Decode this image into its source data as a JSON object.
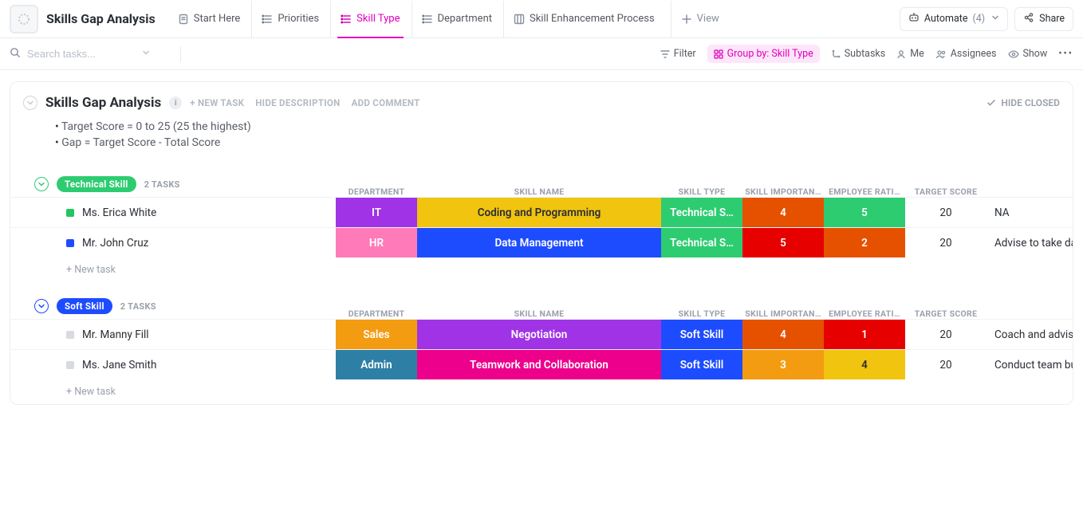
{
  "header": {
    "title": "Skills Gap Analysis"
  },
  "tabs": [
    {
      "label": "Start Here",
      "icon": "doc"
    },
    {
      "label": "Priorities",
      "icon": "list"
    },
    {
      "label": "Skill Type",
      "icon": "list",
      "active": true
    },
    {
      "label": "Department",
      "icon": "list"
    },
    {
      "label": "Skill Enhancement Process",
      "icon": "board"
    }
  ],
  "add_view_label": "View",
  "automate": {
    "label": "Automate",
    "count": "(4)"
  },
  "share_label": "Share",
  "search": {
    "placeholder": "Search tasks..."
  },
  "subbar": {
    "filter": "Filter",
    "groupby": "Group by: Skill Type",
    "subtasks": "Subtasks",
    "me": "Me",
    "assignees": "Assignees",
    "show": "Show"
  },
  "list": {
    "title": "Skills Gap Analysis",
    "new_task": "+ NEW TASK",
    "hide_desc": "HIDE DESCRIPTION",
    "add_comment": "ADD COMMENT",
    "hide_closed": "HIDE CLOSED",
    "description": [
      "Target Score = 0 to 25 (25 the highest)",
      "Gap = Target Score - Total Score"
    ]
  },
  "columns": [
    "DEPARTMENT",
    "SKILL NAME",
    "SKILL TYPE",
    "SKILL IMPORTAN…",
    "EMPLOYEE RATI…",
    "TARGET SCORE"
  ],
  "colors": {
    "green": "#2ecc71",
    "blue": "#1d4cff",
    "orange": "#f39c12",
    "darkorange": "#e65100",
    "red": "#e60000",
    "yellow": "#f1c40f",
    "purple": "#a033e6",
    "magenta": "#ec008c",
    "pink": "#ff6fb5",
    "steel": "#2d7fa6",
    "hrpink": "#ff7ab8"
  },
  "groups": [
    {
      "name": "Technical Skill",
      "pill_bg": "#2ecc71",
      "circle_stroke": "#2ecc71",
      "count": "2 TASKS",
      "rows": [
        {
          "name": "Ms. Erica White",
          "square": "green",
          "cells": [
            {
              "text": "IT",
              "bg": "#a033e6"
            },
            {
              "text": "Coding and Programming",
              "bg": "#f1c40f",
              "fg": "#2a2e34"
            },
            {
              "text": "Technical S…",
              "bg": "#2ecc71"
            },
            {
              "text": "4",
              "bg": "#e65100"
            },
            {
              "text": "5",
              "bg": "#2ecc71"
            }
          ],
          "target": "20",
          "note": "NA"
        },
        {
          "name": "Mr. John Cruz",
          "square": "blue",
          "cells": [
            {
              "text": "HR",
              "bg": "#ff7ab8"
            },
            {
              "text": "Data Management",
              "bg": "#1d4cff"
            },
            {
              "text": "Technical S…",
              "bg": "#2ecc71"
            },
            {
              "text": "5",
              "bg": "#e60000"
            },
            {
              "text": "2",
              "bg": "#e65100"
            }
          ],
          "target": "20",
          "note": "Advise to take data mana"
        }
      ]
    },
    {
      "name": "Soft Skill",
      "pill_bg": "#1d4cff",
      "circle_stroke": "#1d4cff",
      "count": "2 TASKS",
      "rows": [
        {
          "name": "Mr. Manny Fill",
          "square": "grey",
          "cells": [
            {
              "text": "Sales",
              "bg": "#f39c12"
            },
            {
              "text": "Negotiation",
              "bg": "#a033e6"
            },
            {
              "text": "Soft Skill",
              "bg": "#1d4cff"
            },
            {
              "text": "4",
              "bg": "#e65100"
            },
            {
              "text": "1",
              "bg": "#e60000"
            }
          ],
          "target": "20",
          "note": "Coach and advise to take"
        },
        {
          "name": "Ms. Jane Smith",
          "square": "grey",
          "cells": [
            {
              "text": "Admin",
              "bg": "#2d7fa6"
            },
            {
              "text": "Teamwork and Collaboration",
              "bg": "#ec008c"
            },
            {
              "text": "Soft Skill",
              "bg": "#1d4cff"
            },
            {
              "text": "3",
              "bg": "#f39c12"
            },
            {
              "text": "4",
              "bg": "#f1c40f",
              "fg": "#2a2e34"
            }
          ],
          "target": "20",
          "note": "Conduct team building ac"
        }
      ]
    }
  ],
  "new_task_row": "+ New task"
}
